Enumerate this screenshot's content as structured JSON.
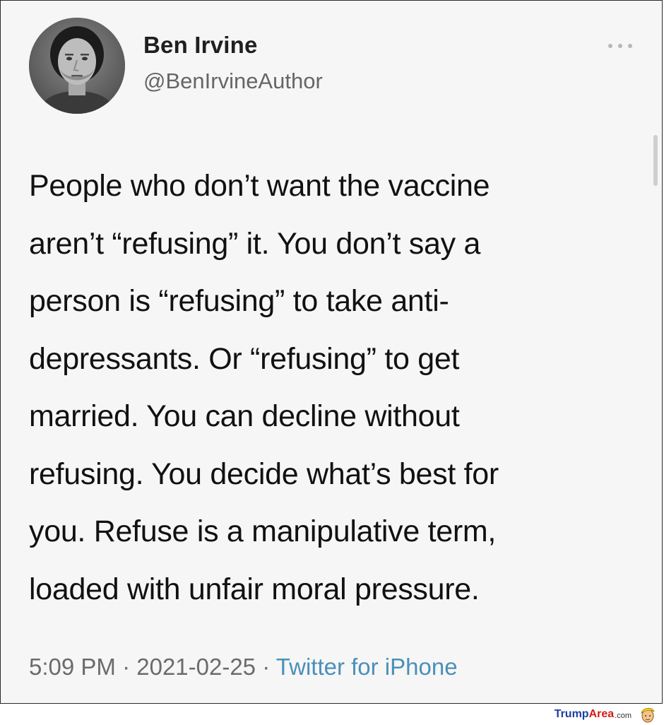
{
  "tweet": {
    "author": {
      "display_name": "Ben Irvine",
      "handle": "@BenIrvineAuthor"
    },
    "text_lines": [
      "People who don’t want the vaccine",
      "aren’t “refusing” it. You don’t say a",
      "person is “refusing” to take anti-",
      "depressants. Or “refusing” to get",
      "married. You can decline without",
      "refusing. You decide what’s best for",
      "you. Refuse is a manipulative term,",
      "loaded with unfair moral pressure."
    ],
    "meta": {
      "time": "5:09 PM",
      "separator": " · ",
      "date": "2021-02-25",
      "source": "Twitter for iPhone"
    },
    "more_icon": "more-horizontal-icon"
  },
  "watermark": {
    "part1": "Trump",
    "part2": "Area",
    "part3": ".com",
    "logo_icon": "trump-face-icon"
  },
  "colors": {
    "card_background": "#f6f6f6",
    "text": "#111111",
    "meta_text": "#6b6b6b",
    "link": "#4a90b8"
  }
}
